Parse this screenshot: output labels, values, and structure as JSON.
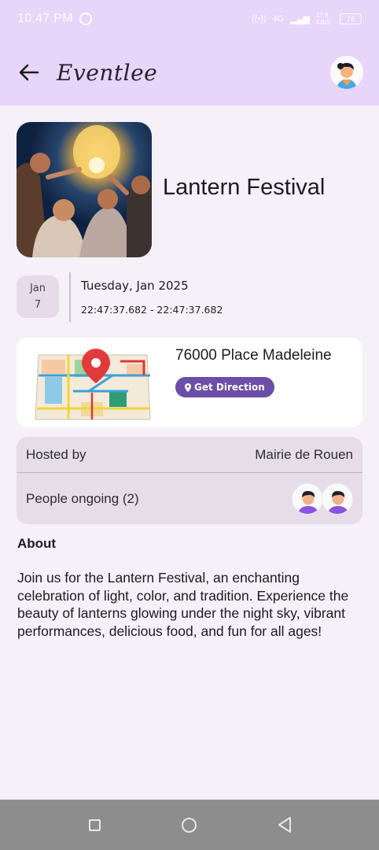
{
  "status_bar": {
    "time": "10:47 PM",
    "network": "4G",
    "speed": "17.8 KB/S",
    "battery": "76"
  },
  "app_bar": {
    "brand": "Eventlee"
  },
  "event": {
    "title": "Lantern Festival",
    "date_month": "Jan",
    "date_day": "7",
    "day_label": "Tuesday, Jan 2025",
    "time_range": "22:47:37.682 - 22:47:37.682"
  },
  "location": {
    "address": "76000 Place Madeleine",
    "direction_label": "Get Direction"
  },
  "info": {
    "hosted_label": "Hosted by",
    "hosted_value": "Mairie de Rouen",
    "people_label": "People ongoing (2)"
  },
  "about": {
    "title": "About",
    "text": "Join us for the Lantern Festival, an enchanting celebration of light, color, and tradition. Experience the beauty of lanterns glowing under the night sky, vibrant performances, delicious food, and fun for all ages!"
  },
  "colors": {
    "header": "#e8d5fa",
    "background": "#f6f0f8",
    "accent": "#6b4ea8",
    "card": "#e6dde9"
  },
  "icons": [
    "back-arrow-icon",
    "profile-avatar",
    "map-pin-icon",
    "nav-recents-icon",
    "nav-home-icon",
    "nav-back-icon"
  ]
}
